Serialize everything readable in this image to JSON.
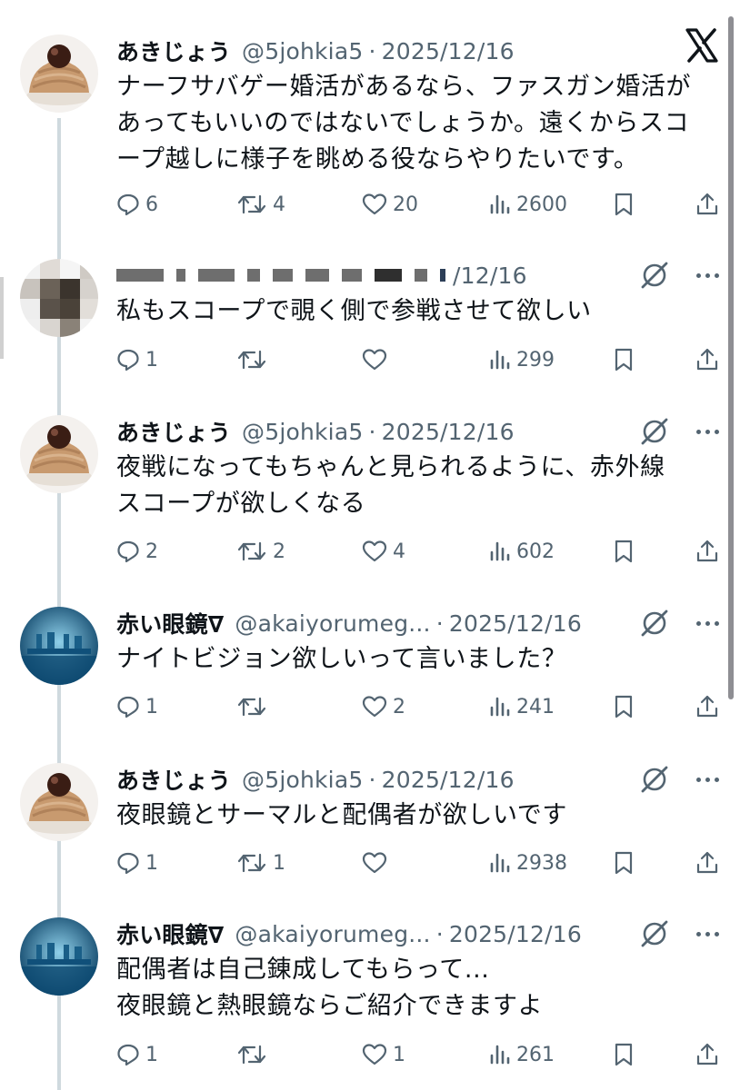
{
  "brand": {
    "logo_icon": "x-logo-icon"
  },
  "posts": [
    {
      "name": "あきじょう",
      "handle": "@5johkia5",
      "date": "2025/12/16",
      "avatar": "monblanc-cake-avatar",
      "lines": [
        "ナーフサバゲー婚活があるなら、ファスガン婚活が",
        "あってもいいのではないでしょうか。遠くからスコ",
        "ープ越しに様子を眺める役ならやりたいです。"
      ],
      "replies": "6",
      "retweets": "4",
      "likes": "20",
      "views": "2600"
    },
    {
      "name": "",
      "handle": "",
      "date": "/12/16",
      "avatar": "pixelated-avatar",
      "redacted": true,
      "lines": [
        "私もスコープで覗く側で参戦させて欲しい"
      ],
      "replies": "1",
      "retweets": "",
      "likes": "",
      "views": "299"
    },
    {
      "name": "あきじょう",
      "handle": "@5johkia5",
      "date": "2025/12/16",
      "avatar": "monblanc-cake-avatar",
      "lines": [
        "夜戦になってもちゃんと見られるように、赤外線",
        "スコープが欲しくなる"
      ],
      "replies": "2",
      "retweets": "2",
      "likes": "4",
      "views": "602"
    },
    {
      "name": "赤い眼鏡∇",
      "handle": "@akaiyorumeg...",
      "date": "2025/12/16",
      "avatar": "night-vision-avatar",
      "lines": [
        "ナイトビジョン欲しいって言いました？"
      ],
      "replies": "1",
      "retweets": "",
      "likes": "2",
      "views": "241"
    },
    {
      "name": "あきじょう",
      "handle": "@5johkia5",
      "date": "2025/12/16",
      "avatar": "monblanc-cake-avatar",
      "lines": [
        "夜眼鏡とサーマルと配偶者が欲しいです"
      ],
      "replies": "1",
      "retweets": "1",
      "likes": "",
      "views": "2938"
    },
    {
      "name": "赤い眼鏡∇",
      "handle": "@akaiyorumeg...",
      "date": "2025/12/16",
      "avatar": "night-vision-avatar",
      "lines": [
        "配偶者は自己錬成してもらって...",
        "夜眼鏡と熱眼鏡ならご紹介できますよ"
      ],
      "replies": "1",
      "retweets": "",
      "likes": "1",
      "views": "261"
    }
  ],
  "separator": "·",
  "icons": {
    "reply": "reply-icon",
    "retweet": "retweet-icon",
    "like": "heart-icon",
    "views": "views-icon",
    "bookmark": "bookmark-icon",
    "share": "share-icon",
    "grok": "grok-icon",
    "more": "more-icon"
  }
}
